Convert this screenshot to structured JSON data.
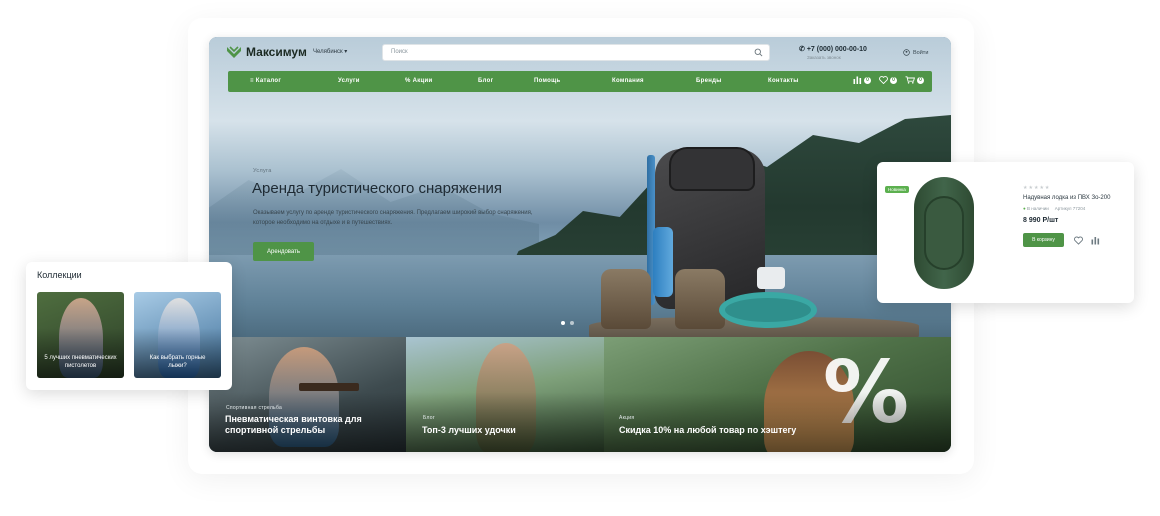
{
  "header": {
    "logo_text": "Максимум",
    "city": "Челябинск",
    "search_placeholder": "Поиск",
    "phone": "+7 (000) 000-00-10",
    "phone_sub": "Заказать звонок",
    "login": "Войти"
  },
  "nav": {
    "items": [
      "Каталог",
      "Услуги",
      "Акции",
      "Блог",
      "Помощь",
      "Компания",
      "Бренды",
      "Контакты"
    ],
    "compare_count": "0",
    "favorites_count": "0",
    "cart_count": "0"
  },
  "hero": {
    "kicker": "Услуга",
    "title": "Аренда туристического снаряжения",
    "description": "Оказываем услугу по аренде туристического снаряжения. Предлагаем широкий выбор снаряжения, которое необходимо на отдыхе и в путешествиях.",
    "button": "Арендовать"
  },
  "tiles": [
    {
      "tag": "Спортивная стрельба",
      "title": "Пневматическая винтовка для спортивной стрельбы"
    },
    {
      "tag": "Блог",
      "title": "Топ-3 лучших удочки"
    },
    {
      "tag": "Акция",
      "title": "Скидка 10% на любой товар по хэштегу"
    }
  ],
  "collections": {
    "title": "Коллекции",
    "cards": [
      {
        "label": "5 лучших пневматических пистолетов"
      },
      {
        "label": "Как выбрать горные лыжи?"
      }
    ]
  },
  "product": {
    "badge": "Новинка",
    "stars": "★★★★★",
    "name": "Надувная лодка из ПВХ Зо-200",
    "availability": "В наличии",
    "article": "Артикул 77204",
    "price": "8 990 Р/шт",
    "button": "В корзину"
  },
  "colors": {
    "brand_green": "#4f9447",
    "badge_green": "#5cb04f",
    "text_dark": "#1e2a33"
  }
}
